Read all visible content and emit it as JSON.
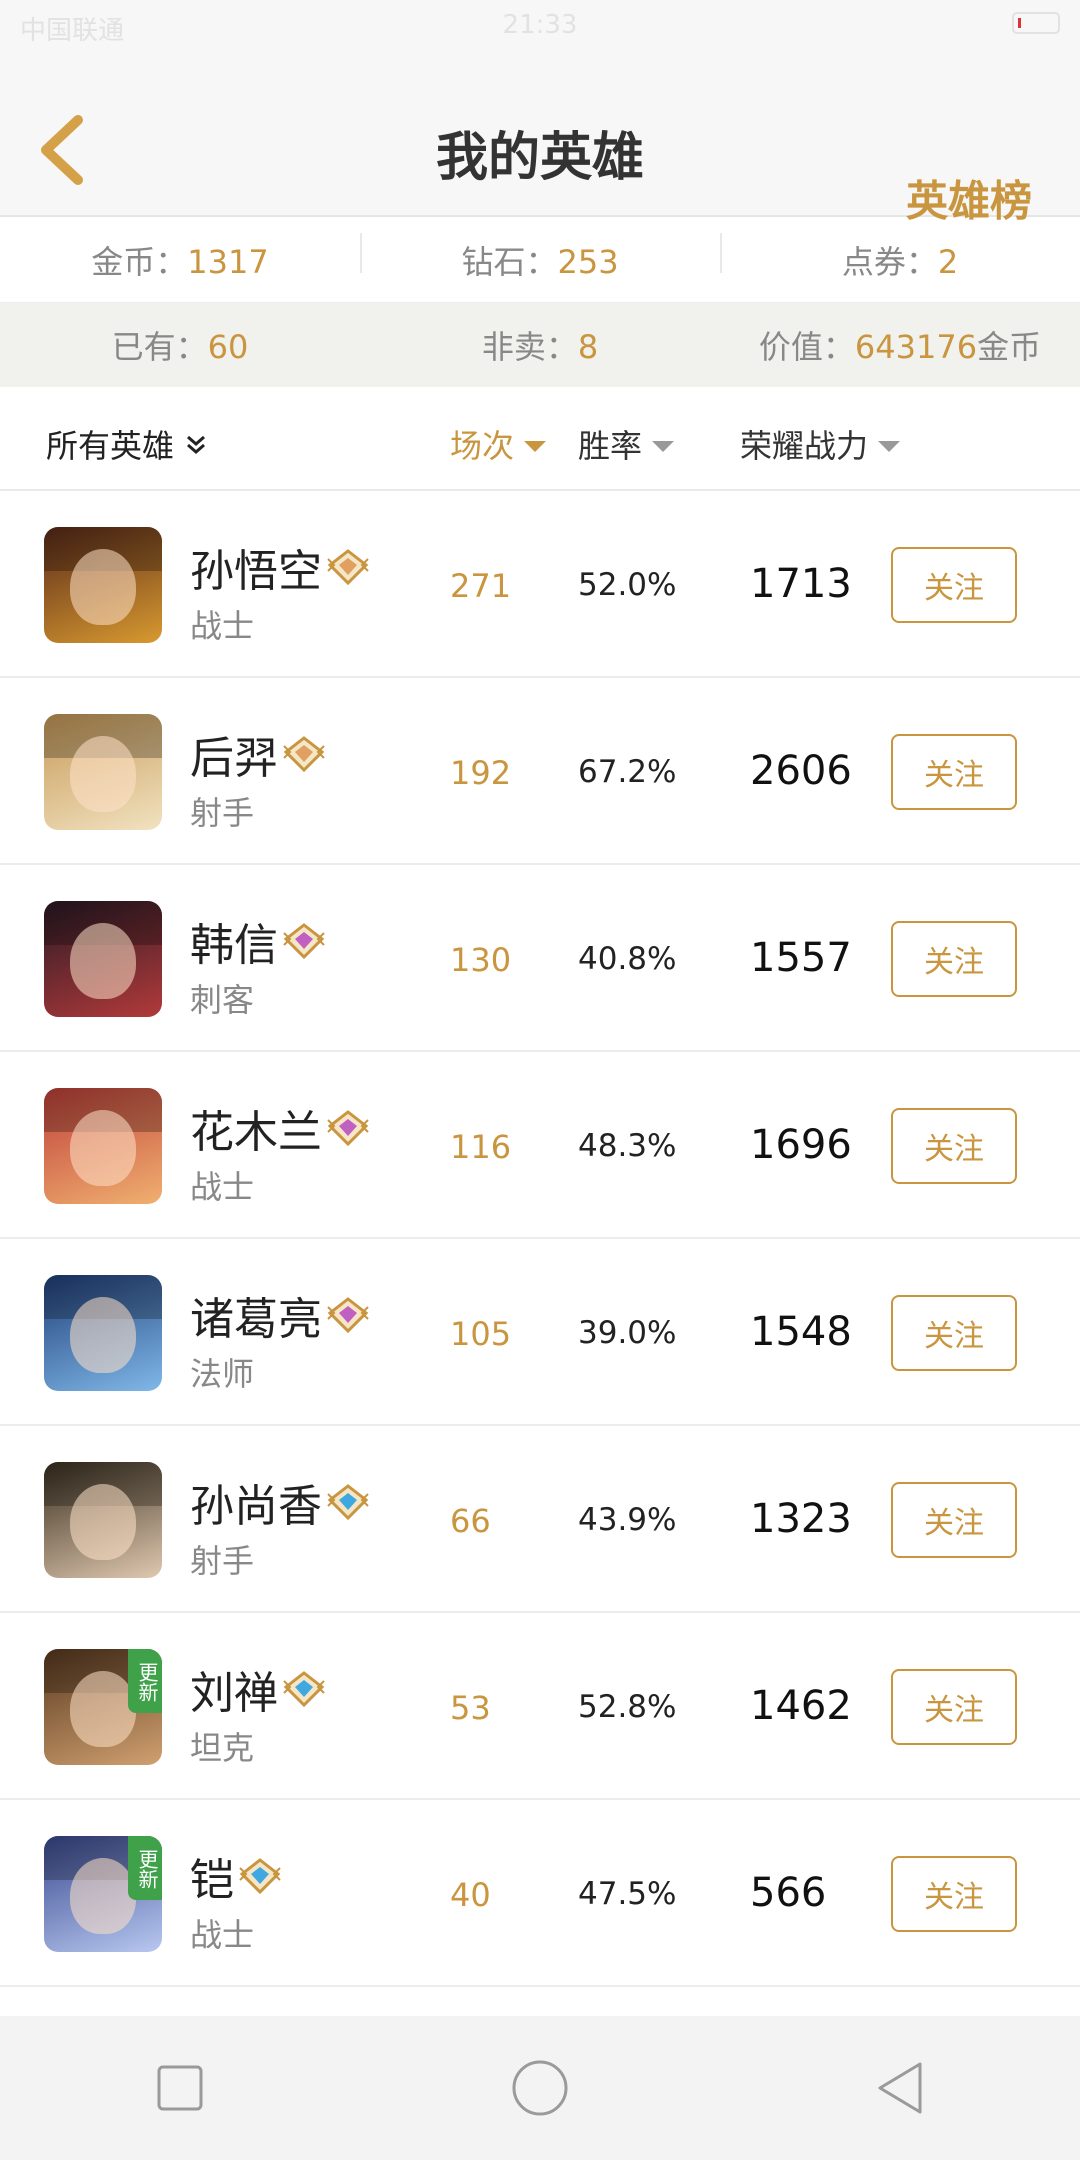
{
  "status_bar": {
    "carrier": "中国联通",
    "time": "21:33"
  },
  "header": {
    "title": "我的英雄",
    "rank_link": "英雄榜"
  },
  "currency": {
    "gold_label": "金币：",
    "gold_value": "1317",
    "diamond_label": "钻石：",
    "diamond_value": "253",
    "voucher_label": "点券：",
    "voucher_value": "2"
  },
  "stats": {
    "owned_label": "已有：",
    "owned_value": "60",
    "not_sale_label": "非卖：",
    "not_sale_value": "8",
    "worth_label": "价值：",
    "worth_value": "643176",
    "worth_unit": "金币"
  },
  "sort_bar": {
    "filter_label": "所有英雄",
    "games_label": "场次",
    "win_label": "胜率",
    "power_label": "荣耀战力"
  },
  "heroes": [
    {
      "name": "孙悟空",
      "role": "战士",
      "games": "271",
      "win_rate": "52.0%",
      "power": "1713",
      "follow": "关注",
      "badge": "gold-badge-icon",
      "new": false,
      "colors": [
        "#5a2a1a",
        "#d89a30"
      ]
    },
    {
      "name": "后羿",
      "role": "射手",
      "games": "192",
      "win_rate": "67.2%",
      "power": "2606",
      "follow": "关注",
      "badge": "gold-badge-icon",
      "new": false,
      "colors": [
        "#c79a58",
        "#f1e2c0"
      ]
    },
    {
      "name": "韩信",
      "role": "刺客",
      "games": "130",
      "win_rate": "40.8%",
      "power": "1557",
      "follow": "关注",
      "badge": "platinum-badge-icon",
      "new": false,
      "colors": [
        "#2b1a26",
        "#b23a3a"
      ]
    },
    {
      "name": "花木兰",
      "role": "战士",
      "games": "116",
      "win_rate": "48.3%",
      "power": "1696",
      "follow": "关注",
      "badge": "platinum-badge-icon",
      "new": false,
      "colors": [
        "#c0403a",
        "#f0b070"
      ]
    },
    {
      "name": "诸葛亮",
      "role": "法师",
      "games": "105",
      "win_rate": "39.0%",
      "power": "1548",
      "follow": "关注",
      "badge": "platinum-badge-icon",
      "new": false,
      "colors": [
        "#20407a",
        "#80b8e8"
      ]
    },
    {
      "name": "孙尚香",
      "role": "射手",
      "games": "66",
      "win_rate": "43.9%",
      "power": "1323",
      "follow": "关注",
      "badge": "diamond-badge-icon",
      "new": false,
      "colors": [
        "#3a3020",
        "#e0c8b0"
      ]
    },
    {
      "name": "刘禅",
      "role": "坦克",
      "games": "53",
      "win_rate": "52.8%",
      "power": "1462",
      "follow": "关注",
      "badge": "diamond-badge-icon",
      "new": true,
      "new_label": "更新",
      "colors": [
        "#5a3a20",
        "#d0a070"
      ]
    },
    {
      "name": "铠",
      "role": "战士",
      "games": "40",
      "win_rate": "47.5%",
      "power": "566",
      "follow": "关注",
      "badge": "diamond-badge-icon",
      "new": true,
      "new_label": "更新",
      "colors": [
        "#3a4a90",
        "#b8c8f0"
      ]
    }
  ],
  "colors": {
    "accent": "#c9953f",
    "gold_badge": "#e0a060",
    "platinum_badge": "#c060c0",
    "diamond_badge": "#40a8e0"
  }
}
